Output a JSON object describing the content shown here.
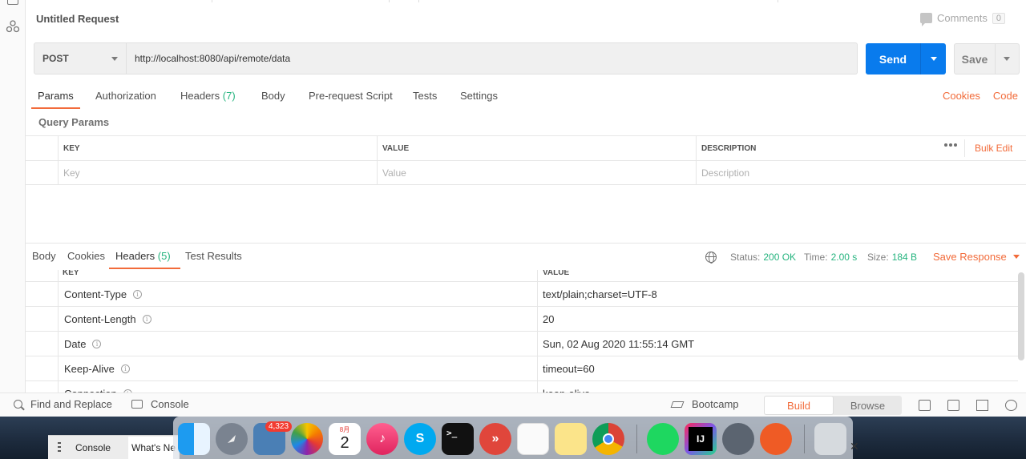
{
  "request": {
    "title": "Untitled Request",
    "comments_label": "Comments",
    "comments_count": "0",
    "method": "POST",
    "url": "http://localhost:8080/api/remote/data",
    "send_label": "Send",
    "save_label": "Save"
  },
  "request_tabs": {
    "params": "Params",
    "authorization": "Authorization",
    "headers": "Headers",
    "headers_count": "(7)",
    "body": "Body",
    "pre_request": "Pre-request Script",
    "tests": "Tests",
    "settings": "Settings",
    "cookies": "Cookies",
    "code": "Code"
  },
  "query_params": {
    "title": "Query Params",
    "columns": [
      "KEY",
      "VALUE",
      "DESCRIPTION"
    ],
    "bulk_edit": "Bulk Edit",
    "placeholders": {
      "key": "Key",
      "value": "Value",
      "description": "Description"
    }
  },
  "response": {
    "tabs": {
      "body": "Body",
      "cookies": "Cookies",
      "headers": "Headers",
      "headers_count": "(5)",
      "test_results": "Test Results"
    },
    "status_label": "Status:",
    "status_value": "200 OK",
    "time_label": "Time:",
    "time_value": "2.00 s",
    "size_label": "Size:",
    "size_value": "184 B",
    "save_response": "Save Response",
    "columns": [
      "KEY",
      "VALUE"
    ],
    "headers": [
      {
        "key": "Content-Type",
        "value": "text/plain;charset=UTF-8"
      },
      {
        "key": "Content-Length",
        "value": "20"
      },
      {
        "key": "Date",
        "value": "Sun, 02 Aug 2020 11:55:14 GMT"
      },
      {
        "key": "Keep-Alive",
        "value": "timeout=60"
      },
      {
        "key": "Connection",
        "value": "keep-alive"
      }
    ]
  },
  "statusbar": {
    "find_replace": "Find and Replace",
    "console": "Console",
    "bootcamp": "Bootcamp",
    "build": "Build",
    "browse": "Browse"
  },
  "dock": {
    "mail_badge": "4,323",
    "calendar_month": "8月",
    "calendar_day": "2"
  },
  "behind_window": {
    "tab1": "Console",
    "tab2": "What's Ne"
  },
  "colors": {
    "accent": "#f26b3a",
    "send_blue": "#097bed",
    "ok_green": "#26b47f"
  }
}
